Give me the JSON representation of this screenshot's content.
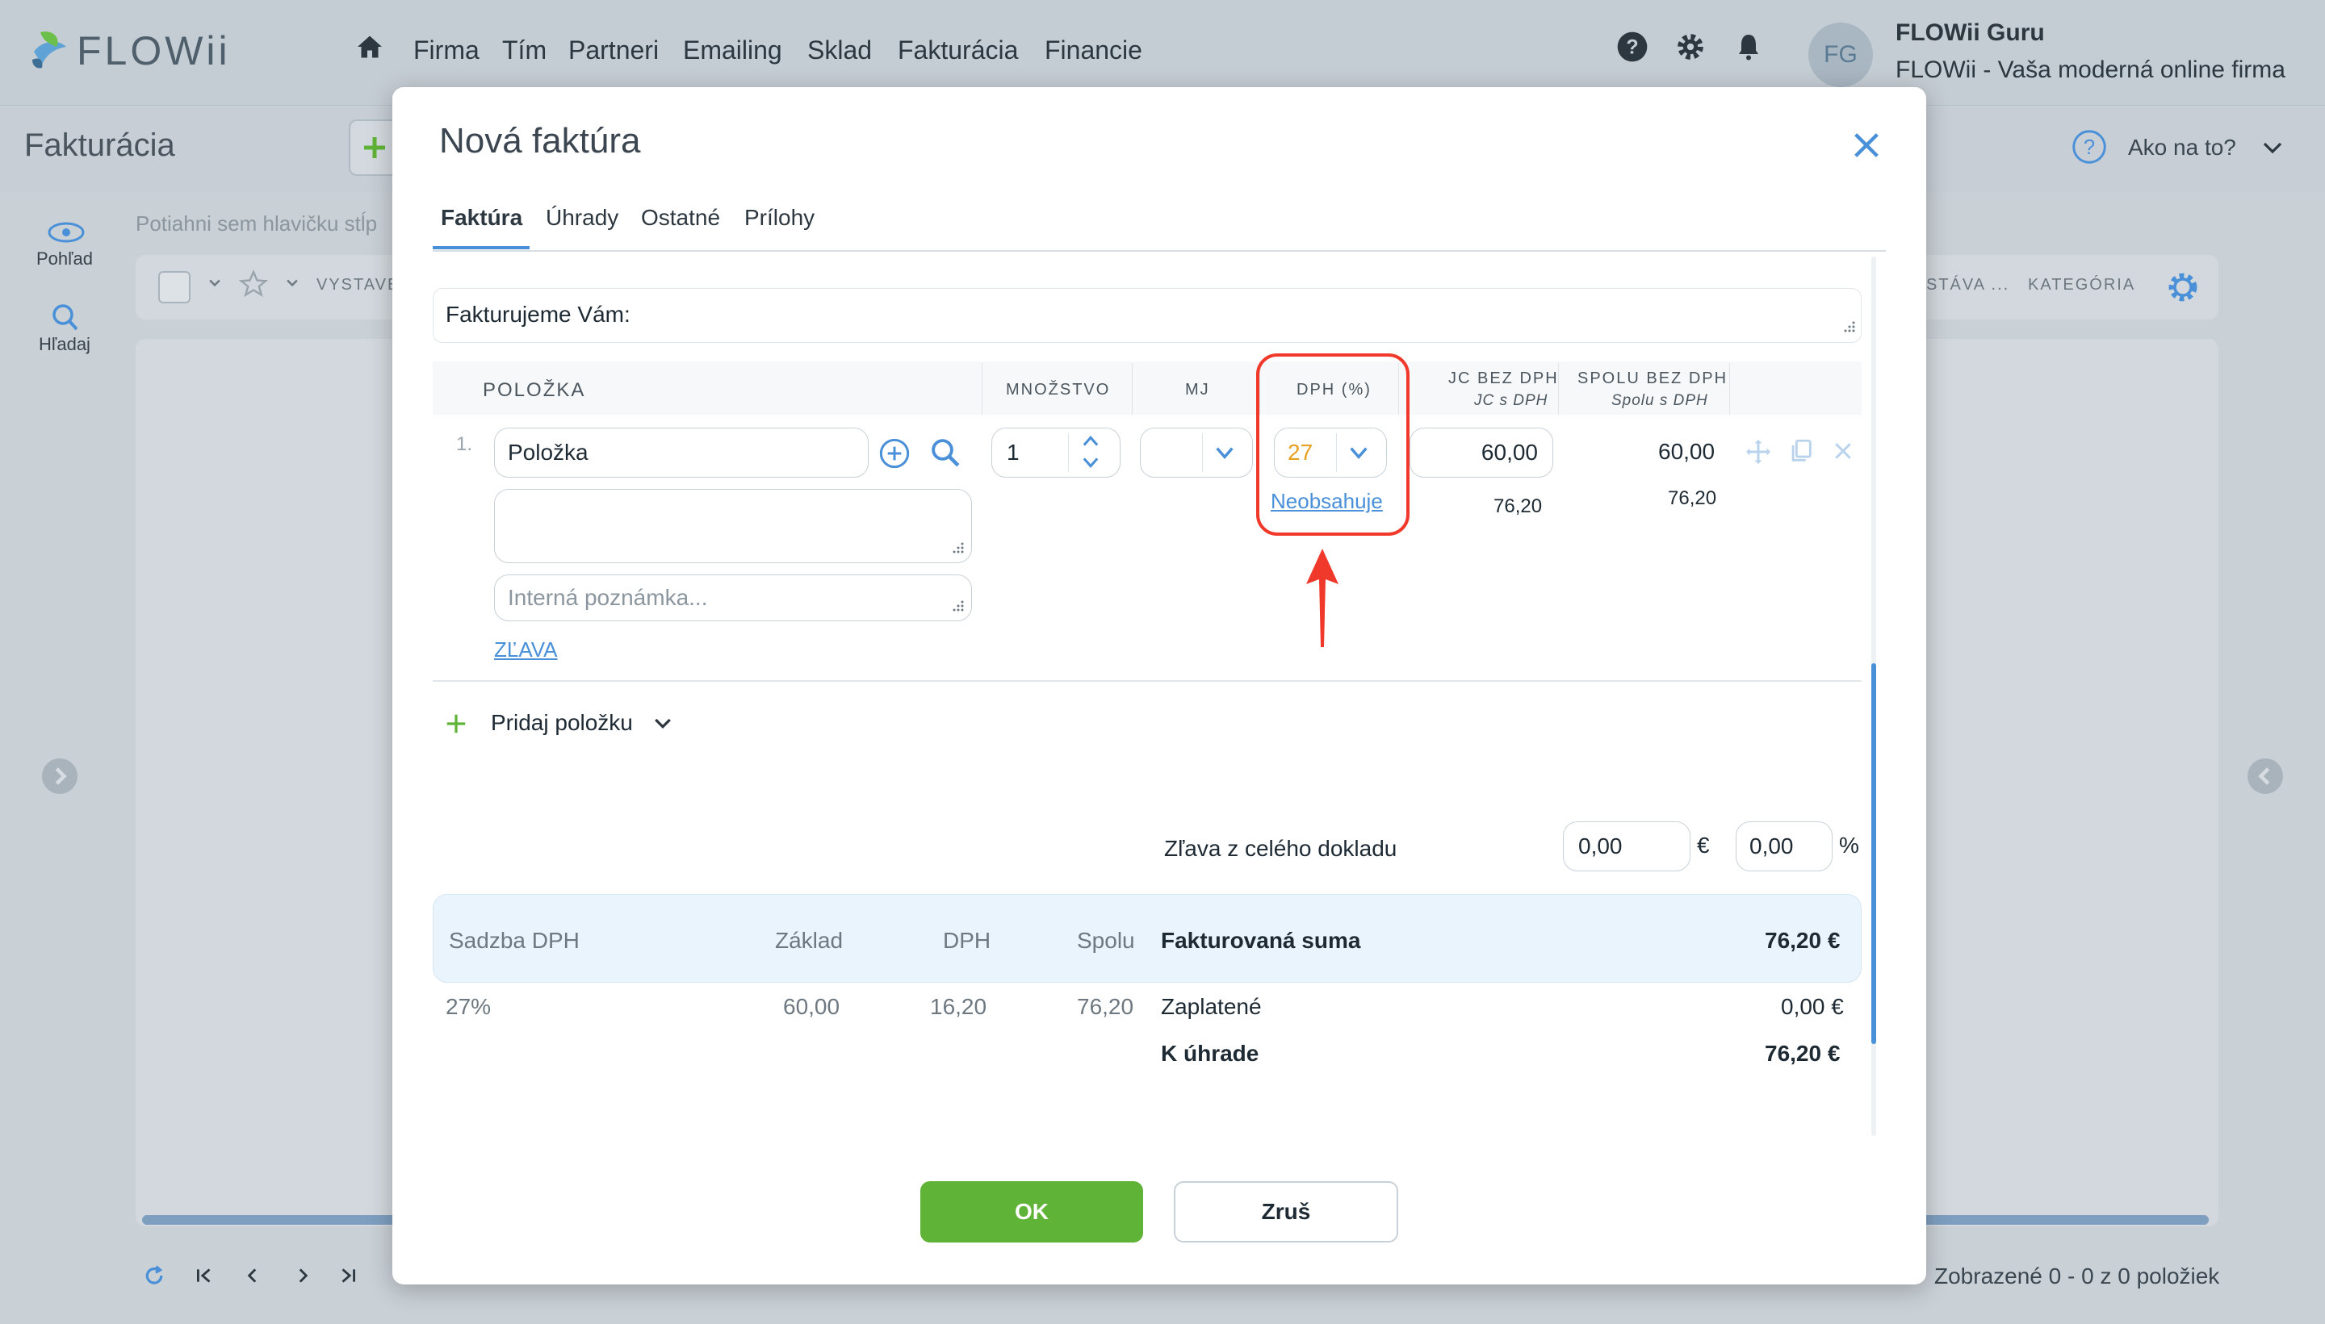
{
  "app": {
    "brand": "FLOWii",
    "nav": [
      "Firma",
      "Tím",
      "Partneri",
      "Emailing",
      "Sklad",
      "Fakturácia",
      "Financie"
    ],
    "user": {
      "initials": "FG",
      "name": "FLOWii Guru",
      "company": "FLOWii - Vaša moderná online firma"
    },
    "page_title": "Fakturácia",
    "help": "Ako na to?",
    "rail": [
      {
        "label": "Pohľad",
        "icon": "eye-icon"
      },
      {
        "label": "Hľadaj",
        "icon": "search-icon"
      }
    ],
    "drop_hint": "Potiahni sem hlavičku stĺp",
    "list_columns": [
      "VYSTAVE",
      "STÁVA ...",
      "KATEGÓRIA"
    ],
    "footer": "Zobrazené 0 - 0 z 0 položiek"
  },
  "modal": {
    "title": "Nová faktúra",
    "tabs": [
      "Faktúra",
      "Úhrady",
      "Ostatné",
      "Prílohy"
    ],
    "active_tab": "Faktúra",
    "intro_label": "Fakturujeme Vám:",
    "columns": {
      "item": "POLOŽKA",
      "qty": "MNOŽSTVO",
      "unit": "MJ",
      "vat": "DPH (%)",
      "unit_price": "JC BEZ DPH",
      "unit_price_vat": "JC s DPH",
      "total": "SPOLU BEZ DPH",
      "total_vat": "Spolu s DPH"
    },
    "row": {
      "number": "1.",
      "item_name": "Položka",
      "note_placeholder": "Interná poznámka...",
      "qty": "1",
      "unit": "",
      "vat": "27",
      "vat_link": "Neobsahuje",
      "unit_price": "60,00",
      "unit_price_vat": "76,20",
      "total": "60,00",
      "total_vat": "76,20",
      "discount_link": "ZĽAVA"
    },
    "add_item": "Pridaj položku",
    "doc_discount_label": "Zľava z celého dokladu",
    "doc_discount_eur": "0,00",
    "doc_discount_pct": "0,00",
    "currency": "€",
    "percent": "%",
    "summary": {
      "headers": [
        "Sadzba DPH",
        "Základ",
        "DPH",
        "Spolu"
      ],
      "row": [
        "27%",
        "60,00",
        "16,20",
        "76,20"
      ],
      "invoiced_label": "Fakturovaná suma",
      "invoiced_value": "76,20 €",
      "paid_label": "Zaplatené",
      "paid_value": "0,00 €",
      "due_label": "K úhrade",
      "due_value": "76,20 €"
    },
    "ok": "OK",
    "cancel": "Zruš",
    "accent_color": "#4a90d9",
    "highlight_color": "#f0392a",
    "ok_color": "#5fb336"
  }
}
